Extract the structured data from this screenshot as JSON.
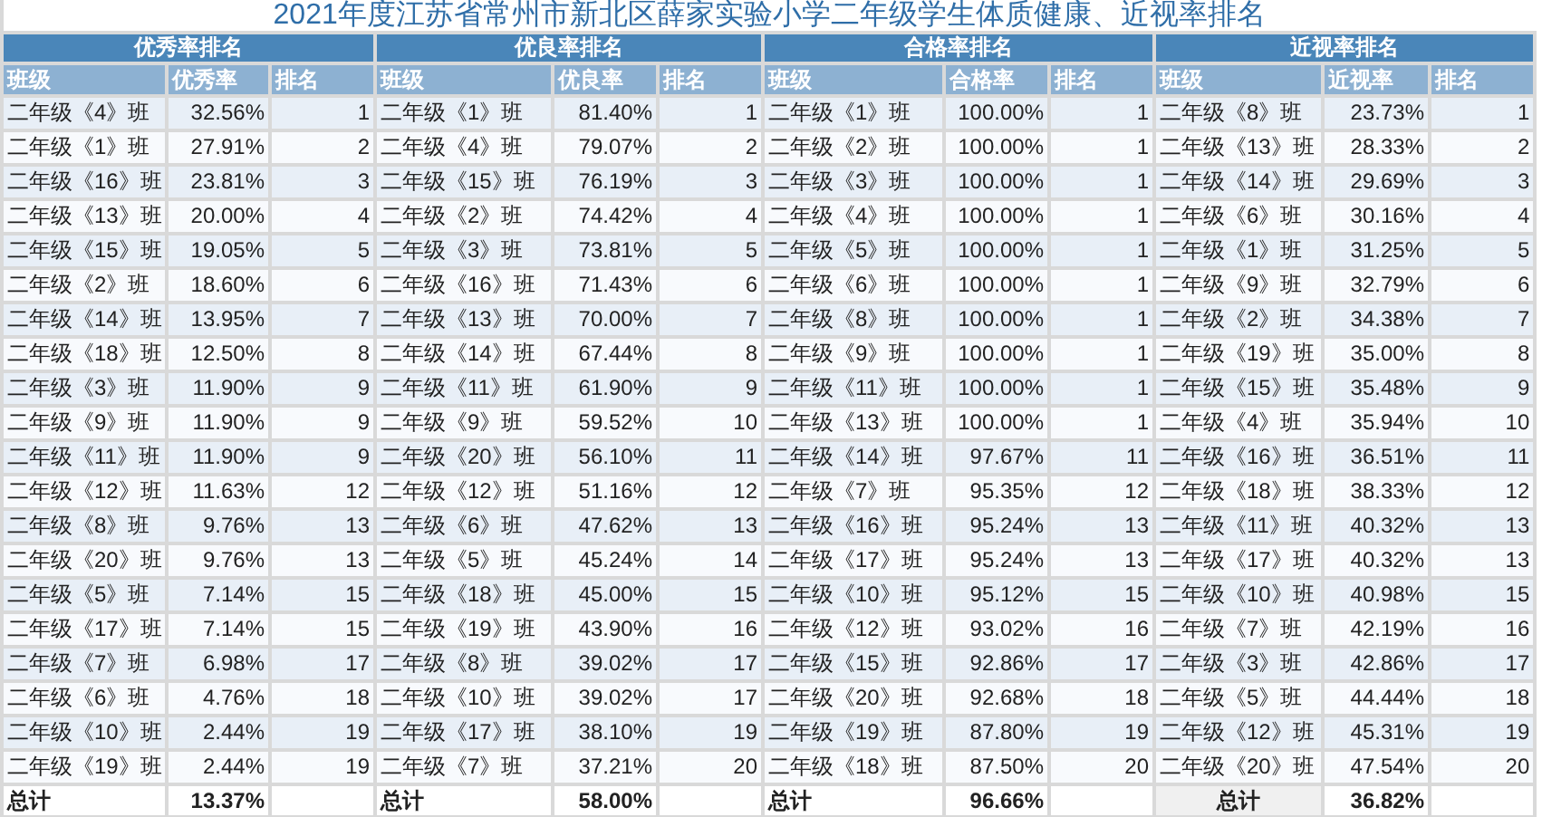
{
  "title": "2021年度江苏省常州市新北区薛家实验小学二年级学生体质健康、近视率排名",
  "sections": [
    {
      "title": "优秀率排名",
      "columns": [
        "班级",
        "优秀率",
        "排名"
      ],
      "total": {
        "label": "总计",
        "value": "13.37%",
        "shaded": false
      },
      "rows": [
        {
          "class": "二年级《4》班",
          "rate": "32.56%",
          "rank": "1"
        },
        {
          "class": "二年级《1》班",
          "rate": "27.91%",
          "rank": "2"
        },
        {
          "class": "二年级《16》班",
          "rate": "23.81%",
          "rank": "3"
        },
        {
          "class": "二年级《13》班",
          "rate": "20.00%",
          "rank": "4"
        },
        {
          "class": "二年级《15》班",
          "rate": "19.05%",
          "rank": "5"
        },
        {
          "class": "二年级《2》班",
          "rate": "18.60%",
          "rank": "6"
        },
        {
          "class": "二年级《14》班",
          "rate": "13.95%",
          "rank": "7"
        },
        {
          "class": "二年级《18》班",
          "rate": "12.50%",
          "rank": "8"
        },
        {
          "class": "二年级《3》班",
          "rate": "11.90%",
          "rank": "9"
        },
        {
          "class": "二年级《9》班",
          "rate": "11.90%",
          "rank": "9"
        },
        {
          "class": "二年级《11》班",
          "rate": "11.90%",
          "rank": "9"
        },
        {
          "class": "二年级《12》班",
          "rate": "11.63%",
          "rank": "12"
        },
        {
          "class": "二年级《8》班",
          "rate": "9.76%",
          "rank": "13"
        },
        {
          "class": "二年级《20》班",
          "rate": "9.76%",
          "rank": "13"
        },
        {
          "class": "二年级《5》班",
          "rate": "7.14%",
          "rank": "15"
        },
        {
          "class": "二年级《17》班",
          "rate": "7.14%",
          "rank": "15"
        },
        {
          "class": "二年级《7》班",
          "rate": "6.98%",
          "rank": "17"
        },
        {
          "class": "二年级《6》班",
          "rate": "4.76%",
          "rank": "18"
        },
        {
          "class": "二年级《10》班",
          "rate": "2.44%",
          "rank": "19"
        },
        {
          "class": "二年级《19》班",
          "rate": "2.44%",
          "rank": "19"
        }
      ]
    },
    {
      "title": "优良率排名",
      "columns": [
        "班级",
        "优良率",
        "排名"
      ],
      "total": {
        "label": "总计",
        "value": "58.00%",
        "shaded": false
      },
      "rows": [
        {
          "class": "二年级《1》班",
          "rate": "81.40%",
          "rank": "1"
        },
        {
          "class": "二年级《4》班",
          "rate": "79.07%",
          "rank": "2"
        },
        {
          "class": "二年级《15》班",
          "rate": "76.19%",
          "rank": "3"
        },
        {
          "class": "二年级《2》班",
          "rate": "74.42%",
          "rank": "4"
        },
        {
          "class": "二年级《3》班",
          "rate": "73.81%",
          "rank": "5"
        },
        {
          "class": "二年级《16》班",
          "rate": "71.43%",
          "rank": "6"
        },
        {
          "class": "二年级《13》班",
          "rate": "70.00%",
          "rank": "7"
        },
        {
          "class": "二年级《14》班",
          "rate": "67.44%",
          "rank": "8"
        },
        {
          "class": "二年级《11》班",
          "rate": "61.90%",
          "rank": "9"
        },
        {
          "class": "二年级《9》班",
          "rate": "59.52%",
          "rank": "10"
        },
        {
          "class": "二年级《20》班",
          "rate": "56.10%",
          "rank": "11"
        },
        {
          "class": "二年级《12》班",
          "rate": "51.16%",
          "rank": "12"
        },
        {
          "class": "二年级《6》班",
          "rate": "47.62%",
          "rank": "13"
        },
        {
          "class": "二年级《5》班",
          "rate": "45.24%",
          "rank": "14"
        },
        {
          "class": "二年级《18》班",
          "rate": "45.00%",
          "rank": "15"
        },
        {
          "class": "二年级《19》班",
          "rate": "43.90%",
          "rank": "16"
        },
        {
          "class": "二年级《8》班",
          "rate": "39.02%",
          "rank": "17"
        },
        {
          "class": "二年级《10》班",
          "rate": "39.02%",
          "rank": "17"
        },
        {
          "class": "二年级《17》班",
          "rate": "38.10%",
          "rank": "19"
        },
        {
          "class": "二年级《7》班",
          "rate": "37.21%",
          "rank": "20"
        }
      ]
    },
    {
      "title": "合格率排名",
      "columns": [
        "班级",
        "合格率",
        "排名"
      ],
      "total": {
        "label": "总计",
        "value": "96.66%",
        "shaded": false
      },
      "rows": [
        {
          "class": "二年级《1》班",
          "rate": "100.00%",
          "rank": "1"
        },
        {
          "class": "二年级《2》班",
          "rate": "100.00%",
          "rank": "1"
        },
        {
          "class": "二年级《3》班",
          "rate": "100.00%",
          "rank": "1"
        },
        {
          "class": "二年级《4》班",
          "rate": "100.00%",
          "rank": "1"
        },
        {
          "class": "二年级《5》班",
          "rate": "100.00%",
          "rank": "1"
        },
        {
          "class": "二年级《6》班",
          "rate": "100.00%",
          "rank": "1"
        },
        {
          "class": "二年级《8》班",
          "rate": "100.00%",
          "rank": "1"
        },
        {
          "class": "二年级《9》班",
          "rate": "100.00%",
          "rank": "1"
        },
        {
          "class": "二年级《11》班",
          "rate": "100.00%",
          "rank": "1"
        },
        {
          "class": "二年级《13》班",
          "rate": "100.00%",
          "rank": "1"
        },
        {
          "class": "二年级《14》班",
          "rate": "97.67%",
          "rank": "11"
        },
        {
          "class": "二年级《7》班",
          "rate": "95.35%",
          "rank": "12"
        },
        {
          "class": "二年级《16》班",
          "rate": "95.24%",
          "rank": "13"
        },
        {
          "class": "二年级《17》班",
          "rate": "95.24%",
          "rank": "13"
        },
        {
          "class": "二年级《10》班",
          "rate": "95.12%",
          "rank": "15"
        },
        {
          "class": "二年级《12》班",
          "rate": "93.02%",
          "rank": "16"
        },
        {
          "class": "二年级《15》班",
          "rate": "92.86%",
          "rank": "17"
        },
        {
          "class": "二年级《20》班",
          "rate": "92.68%",
          "rank": "18"
        },
        {
          "class": "二年级《19》班",
          "rate": "87.80%",
          "rank": "19"
        },
        {
          "class": "二年级《18》班",
          "rate": "87.50%",
          "rank": "20"
        }
      ]
    },
    {
      "title": "近视率排名",
      "columns": [
        "班级",
        "近视率",
        "排名"
      ],
      "total": {
        "label": "总计",
        "value": "36.82%",
        "shaded": true
      },
      "rows": [
        {
          "class": "二年级《8》班",
          "rate": "23.73%",
          "rank": "1"
        },
        {
          "class": "二年级《13》班",
          "rate": "28.33%",
          "rank": "2"
        },
        {
          "class": "二年级《14》班",
          "rate": "29.69%",
          "rank": "3"
        },
        {
          "class": "二年级《6》班",
          "rate": "30.16%",
          "rank": "4"
        },
        {
          "class": "二年级《1》班",
          "rate": "31.25%",
          "rank": "5"
        },
        {
          "class": "二年级《9》班",
          "rate": "32.79%",
          "rank": "6"
        },
        {
          "class": "二年级《2》班",
          "rate": "34.38%",
          "rank": "7"
        },
        {
          "class": "二年级《19》班",
          "rate": "35.00%",
          "rank": "8"
        },
        {
          "class": "二年级《15》班",
          "rate": "35.48%",
          "rank": "9"
        },
        {
          "class": "二年级《4》班",
          "rate": "35.94%",
          "rank": "10"
        },
        {
          "class": "二年级《16》班",
          "rate": "36.51%",
          "rank": "11"
        },
        {
          "class": "二年级《18》班",
          "rate": "38.33%",
          "rank": "12"
        },
        {
          "class": "二年级《11》班",
          "rate": "40.32%",
          "rank": "13"
        },
        {
          "class": "二年级《17》班",
          "rate": "40.32%",
          "rank": "13"
        },
        {
          "class": "二年级《10》班",
          "rate": "40.98%",
          "rank": "15"
        },
        {
          "class": "二年级《7》班",
          "rate": "42.19%",
          "rank": "16"
        },
        {
          "class": "二年级《3》班",
          "rate": "42.86%",
          "rank": "17"
        },
        {
          "class": "二年级《5》班",
          "rate": "44.44%",
          "rank": "18"
        },
        {
          "class": "二年级《12》班",
          "rate": "45.31%",
          "rank": "19"
        },
        {
          "class": "二年级《20》班",
          "rate": "47.54%",
          "rank": "20"
        }
      ]
    }
  ]
}
